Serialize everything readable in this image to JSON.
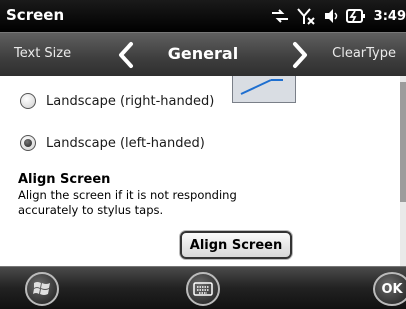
{
  "status_bar": {
    "title": "Screen",
    "time": "3:49",
    "icons": [
      "connectivity-icon",
      "signal-off-icon",
      "volume-icon",
      "battery-charging-icon"
    ]
  },
  "tabs": {
    "previous": "Text Size",
    "current": "General",
    "next": "ClearType"
  },
  "options": [
    {
      "label": "Landscape (right-handed)",
      "selected": false
    },
    {
      "label": "Landscape (left-handed)",
      "selected": true
    }
  ],
  "align": {
    "heading": "Align Screen",
    "description": "Align the screen if it is not responding accurately to stylus taps.",
    "button_label": "Align Screen"
  },
  "bottom_bar": {
    "ok_label": "OK",
    "icons": [
      "windows-start-icon",
      "keyboard-icon"
    ]
  }
}
